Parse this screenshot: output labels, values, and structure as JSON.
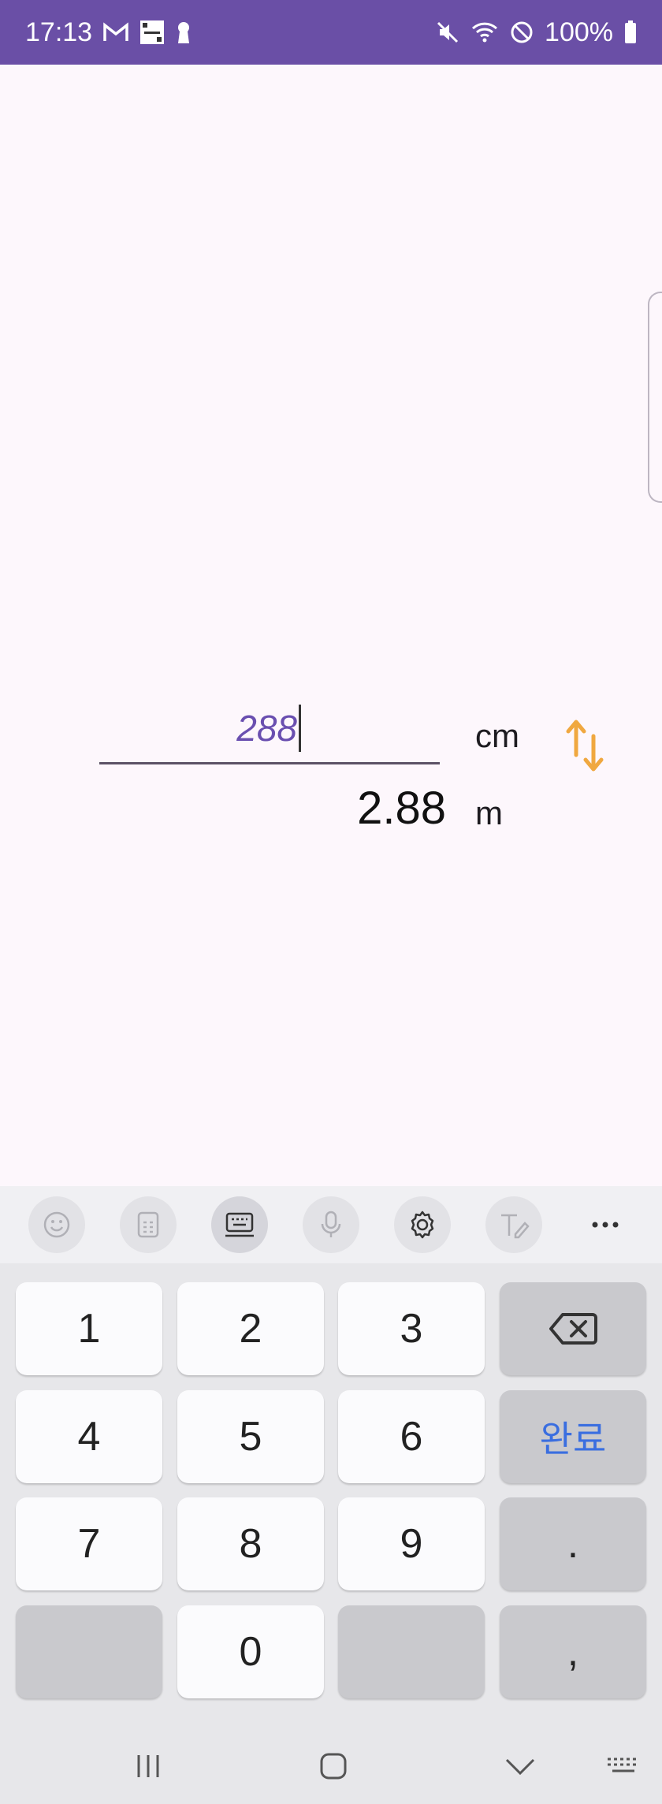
{
  "status_bar": {
    "time": "17:13",
    "battery": "100%"
  },
  "converter": {
    "input_value": "288",
    "from_unit": "cm",
    "result_value": "2.88",
    "to_unit": "m",
    "accent_color": "#6a4fb0",
    "swap_color": "#f0a840"
  },
  "keyboard": {
    "toolbar_icons": [
      "emoji-icon",
      "clipboard-icon",
      "keyboard-layout-icon",
      "mic-icon",
      "settings-icon",
      "handwriting-icon",
      "more-icon"
    ],
    "keys": {
      "k1": "1",
      "k2": "2",
      "k3": "3",
      "k4": "4",
      "k5": "5",
      "k6": "6",
      "k7": "7",
      "k8": "8",
      "k9": "9",
      "k0": "0",
      "done": "완료",
      "dot": ".",
      "comma": ","
    }
  }
}
